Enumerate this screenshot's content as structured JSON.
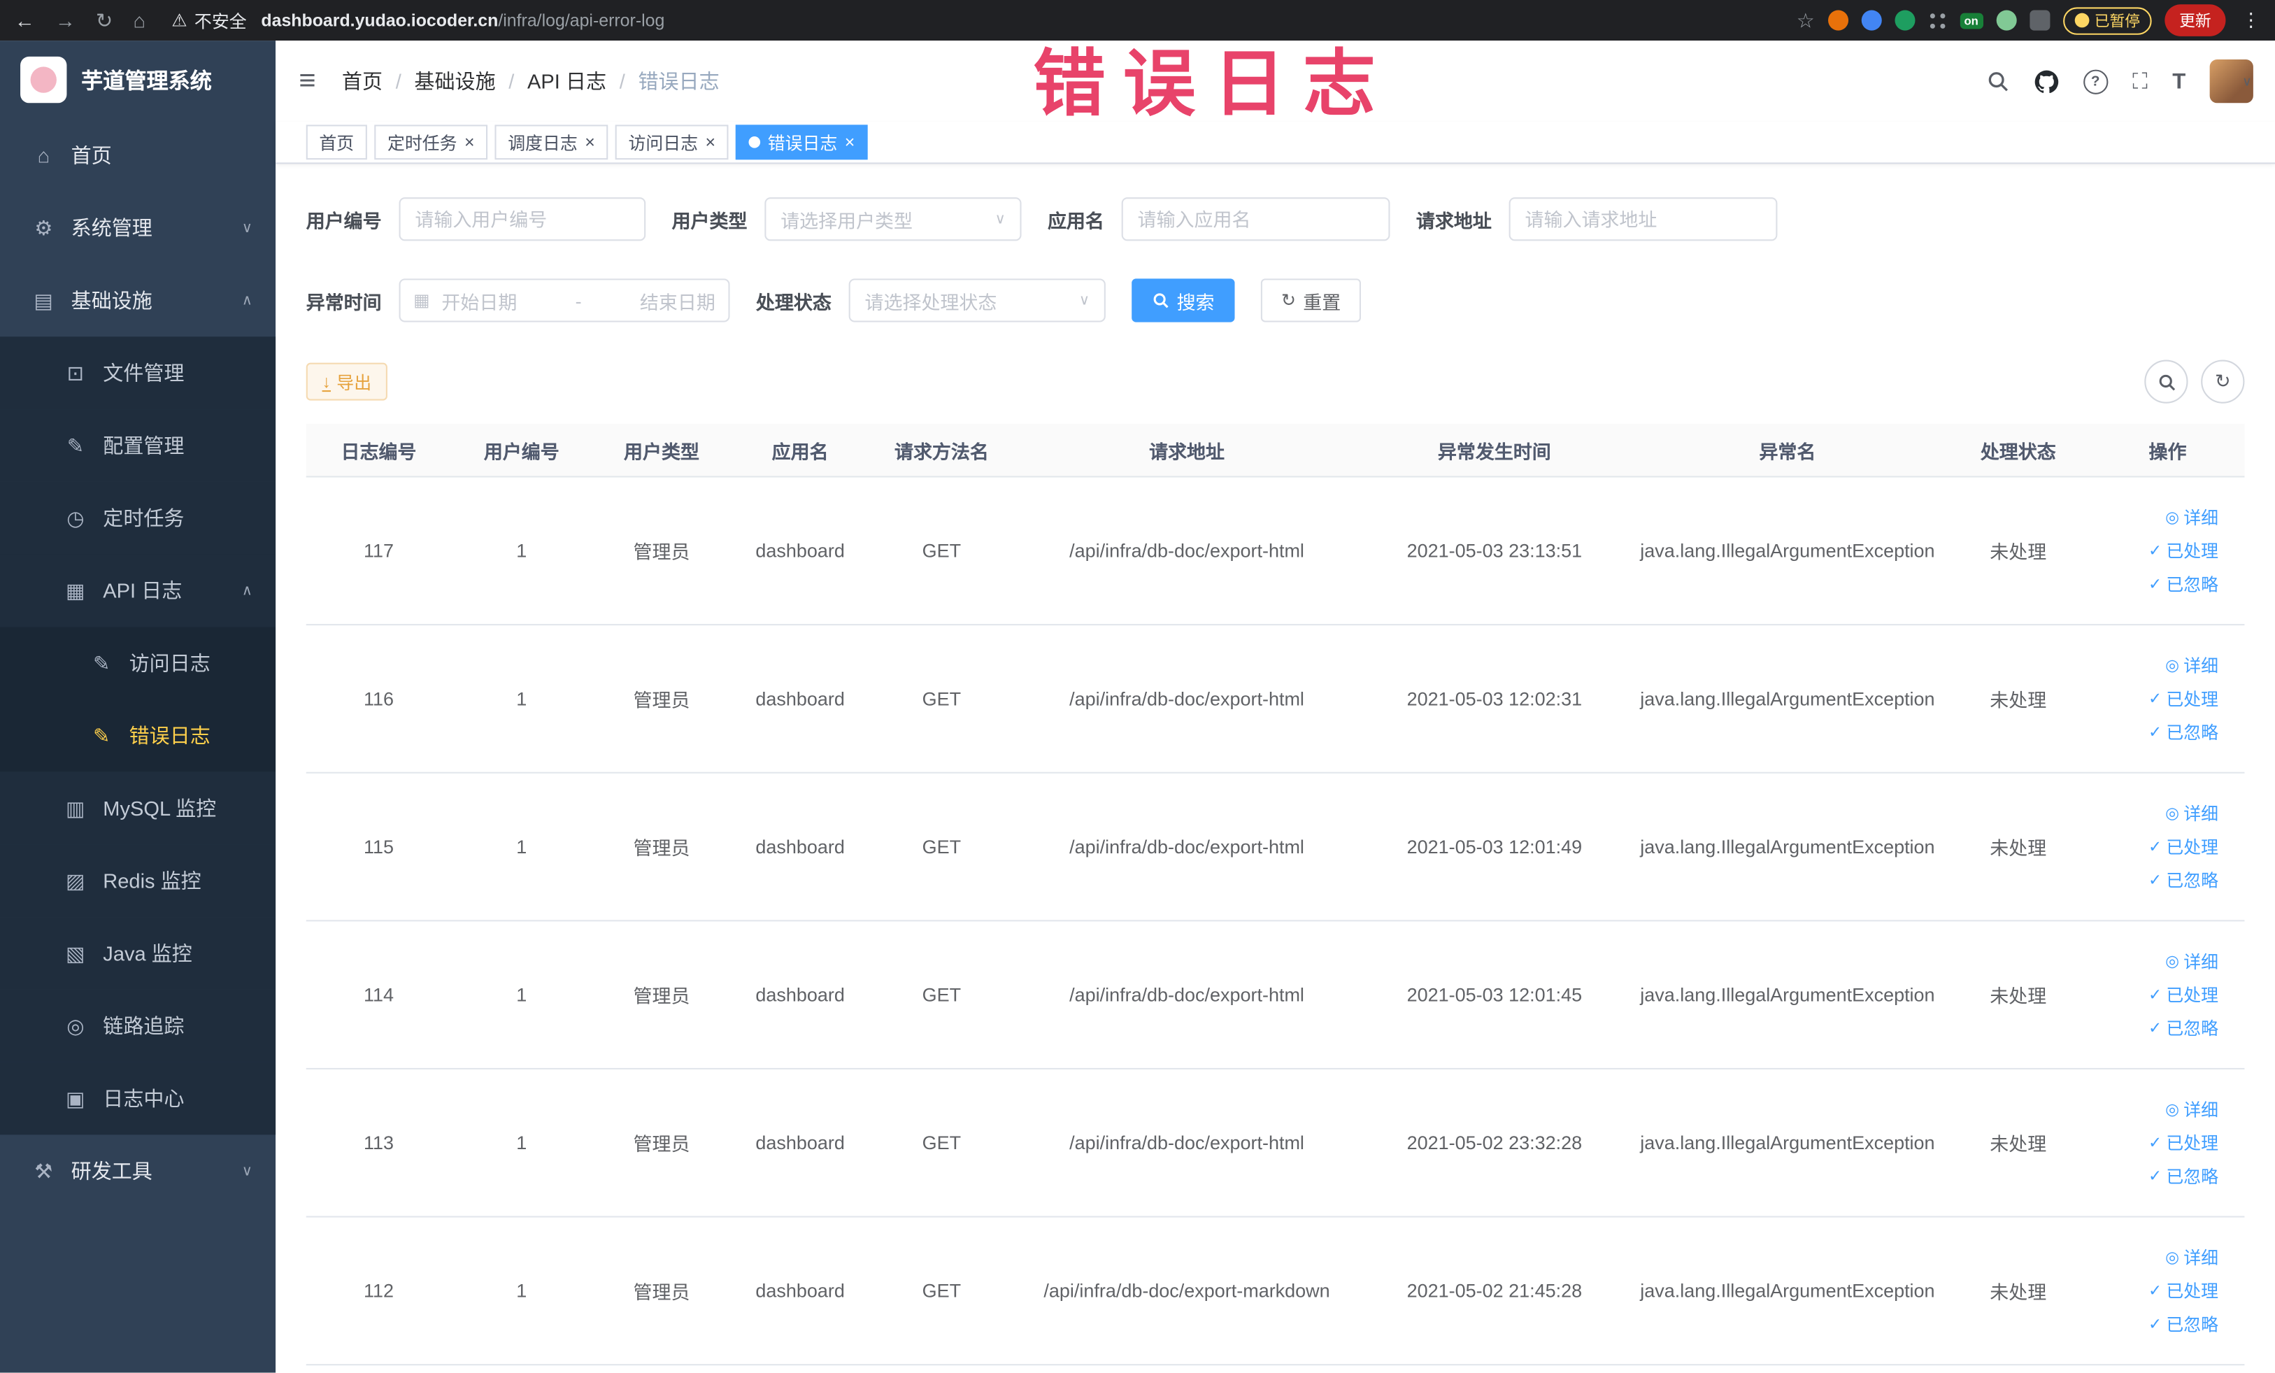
{
  "browser": {
    "security_warning": "不安全",
    "url_host": "dashboard.yudao.iocoder.cn",
    "url_path": "/infra/log/api-error-log",
    "on_badge": "on",
    "paused_badge": "已暂停",
    "update_button": "更新"
  },
  "annotation": {
    "text": "错误日志",
    "color": "#e8436a"
  },
  "icons": {
    "back": "←",
    "forward": "→",
    "reload": "↻",
    "home": "⌂",
    "warning": "⚠",
    "star": "☆",
    "menu_dots": "⋮",
    "hamburger": "≡",
    "question": "?",
    "fullscreen": "⛶",
    "fontsize": "T",
    "caret_down": "∨",
    "caret_up": "∧",
    "calendar": "▦",
    "refresh": "↻",
    "export": "↓",
    "separator": "/",
    "close": "×",
    "eye": "◎",
    "check": "✓"
  },
  "colors": {
    "accent": "#409eff",
    "sidebar_bg": "#304156",
    "submenu_bg": "#1f2d3d",
    "active_menu": "#ffd04b",
    "warning_btn": "#e6a23c",
    "annotation": "#e8436a"
  },
  "sidebar": {
    "title": "芋道管理系统",
    "items": [
      {
        "id": "home",
        "label": "首页",
        "level": 1,
        "icon": "home-icon",
        "glyph": "⌂"
      },
      {
        "id": "system",
        "label": "系统管理",
        "level": 1,
        "icon": "gear-icon",
        "glyph": "⚙",
        "arrow": "down"
      },
      {
        "id": "infra",
        "label": "基础设施",
        "level": 1,
        "icon": "infra-icon",
        "glyph": "▤",
        "arrow": "up"
      },
      {
        "id": "file",
        "label": "文件管理",
        "level": 2,
        "icon": "file-icon",
        "glyph": "⊡"
      },
      {
        "id": "config",
        "label": "配置管理",
        "level": 2,
        "icon": "edit-icon",
        "glyph": "✎"
      },
      {
        "id": "job",
        "label": "定时任务",
        "level": 2,
        "icon": "timer-icon",
        "glyph": "◷"
      },
      {
        "id": "api-log",
        "label": "API 日志",
        "level": 2,
        "icon": "log-icon",
        "glyph": "▦",
        "arrow": "up"
      },
      {
        "id": "access-log",
        "label": "访问日志",
        "level": 3,
        "icon": "doc-edit-icon",
        "glyph": "✎"
      },
      {
        "id": "error-log",
        "label": "错误日志",
        "level": 3,
        "icon": "doc-edit-icon",
        "glyph": "✎",
        "active": true
      },
      {
        "id": "mysql",
        "label": "MySQL 监控",
        "level": 2,
        "icon": "mysql-icon",
        "glyph": "▥"
      },
      {
        "id": "redis",
        "label": "Redis 监控",
        "level": 2,
        "icon": "redis-icon",
        "glyph": "▨"
      },
      {
        "id": "java",
        "label": "Java 监控",
        "level": 2,
        "icon": "java-icon",
        "glyph": "▧"
      },
      {
        "id": "tracer",
        "label": "链路追踪",
        "level": 2,
        "icon": "trace-icon",
        "glyph": "◎"
      },
      {
        "id": "log-center",
        "label": "日志中心",
        "level": 2,
        "icon": "log-center-icon",
        "glyph": "▣"
      },
      {
        "id": "dev-tools",
        "label": "研发工具",
        "level": 1,
        "icon": "tools-icon",
        "glyph": "⚒",
        "arrow": "down"
      }
    ]
  },
  "header": {
    "breadcrumb": [
      {
        "id": "home",
        "label": "首页"
      },
      {
        "id": "infra",
        "label": "基础设施"
      },
      {
        "id": "api-log",
        "label": "API 日志"
      },
      {
        "id": "error-log",
        "label": "错误日志"
      }
    ]
  },
  "tabs": [
    {
      "id": "home",
      "label": "首页",
      "closable": false,
      "active": false
    },
    {
      "id": "job",
      "label": "定时任务",
      "closable": true,
      "active": false
    },
    {
      "id": "job-log",
      "label": "调度日志",
      "closable": true,
      "active": false
    },
    {
      "id": "access-log",
      "label": "访问日志",
      "closable": true,
      "active": false
    },
    {
      "id": "error-log",
      "label": "错误日志",
      "closable": true,
      "active": true
    }
  ],
  "filters": {
    "user_id": {
      "label": "用户编号",
      "placeholder": "请输入用户编号"
    },
    "user_type": {
      "label": "用户类型",
      "placeholder": "请选择用户类型"
    },
    "app_name": {
      "label": "应用名",
      "placeholder": "请输入应用名"
    },
    "request_url": {
      "label": "请求地址",
      "placeholder": "请输入请求地址"
    },
    "exception_time": {
      "label": "异常时间",
      "start_placeholder": "开始日期",
      "separator": "-",
      "end_placeholder": "结束日期"
    },
    "process_status": {
      "label": "处理状态",
      "placeholder": "请选择处理状态"
    },
    "search_button": "搜索",
    "reset_button": "重置"
  },
  "toolbar": {
    "export_button": "导出"
  },
  "table": {
    "columns": [
      "日志编号",
      "用户编号",
      "用户类型",
      "应用名",
      "请求方法名",
      "请求地址",
      "异常发生时间",
      "异常名",
      "处理状态",
      "操作"
    ],
    "row_keys": [
      "id",
      "user_id",
      "user_type",
      "app",
      "method",
      "url",
      "time",
      "exception",
      "status"
    ],
    "actions": [
      {
        "id": "detail",
        "label": "详细",
        "icon": "eye-icon",
        "glyph": "◎"
      },
      {
        "id": "process",
        "label": "已处理",
        "icon": "check-icon",
        "glyph": "✓"
      },
      {
        "id": "ignore",
        "label": "已忽略",
        "icon": "check-icon",
        "glyph": "✓"
      }
    ],
    "rows": [
      {
        "id": "117",
        "user_id": "1",
        "user_type": "管理员",
        "app": "dashboard",
        "method": "GET",
        "url": "/api/infra/db-doc/export-html",
        "time": "2021-05-03 23:13:51",
        "exception": "java.lang.IllegalArgumentException",
        "status": "未处理"
      },
      {
        "id": "116",
        "user_id": "1",
        "user_type": "管理员",
        "app": "dashboard",
        "method": "GET",
        "url": "/api/infra/db-doc/export-html",
        "time": "2021-05-03 12:02:31",
        "exception": "java.lang.IllegalArgumentException",
        "status": "未处理"
      },
      {
        "id": "115",
        "user_id": "1",
        "user_type": "管理员",
        "app": "dashboard",
        "method": "GET",
        "url": "/api/infra/db-doc/export-html",
        "time": "2021-05-03 12:01:49",
        "exception": "java.lang.IllegalArgumentException",
        "status": "未处理"
      },
      {
        "id": "114",
        "user_id": "1",
        "user_type": "管理员",
        "app": "dashboard",
        "method": "GET",
        "url": "/api/infra/db-doc/export-html",
        "time": "2021-05-03 12:01:45",
        "exception": "java.lang.IllegalArgumentException",
        "status": "未处理"
      },
      {
        "id": "113",
        "user_id": "1",
        "user_type": "管理员",
        "app": "dashboard",
        "method": "GET",
        "url": "/api/infra/db-doc/export-html",
        "time": "2021-05-02 23:32:28",
        "exception": "java.lang.IllegalArgumentException",
        "status": "未处理"
      },
      {
        "id": "112",
        "user_id": "1",
        "user_type": "管理员",
        "app": "dashboard",
        "method": "GET",
        "url": "/api/infra/db-doc/export-markdown",
        "time": "2021-05-02 21:45:28",
        "exception": "java.lang.IllegalArgumentException",
        "status": "未处理"
      }
    ]
  }
}
